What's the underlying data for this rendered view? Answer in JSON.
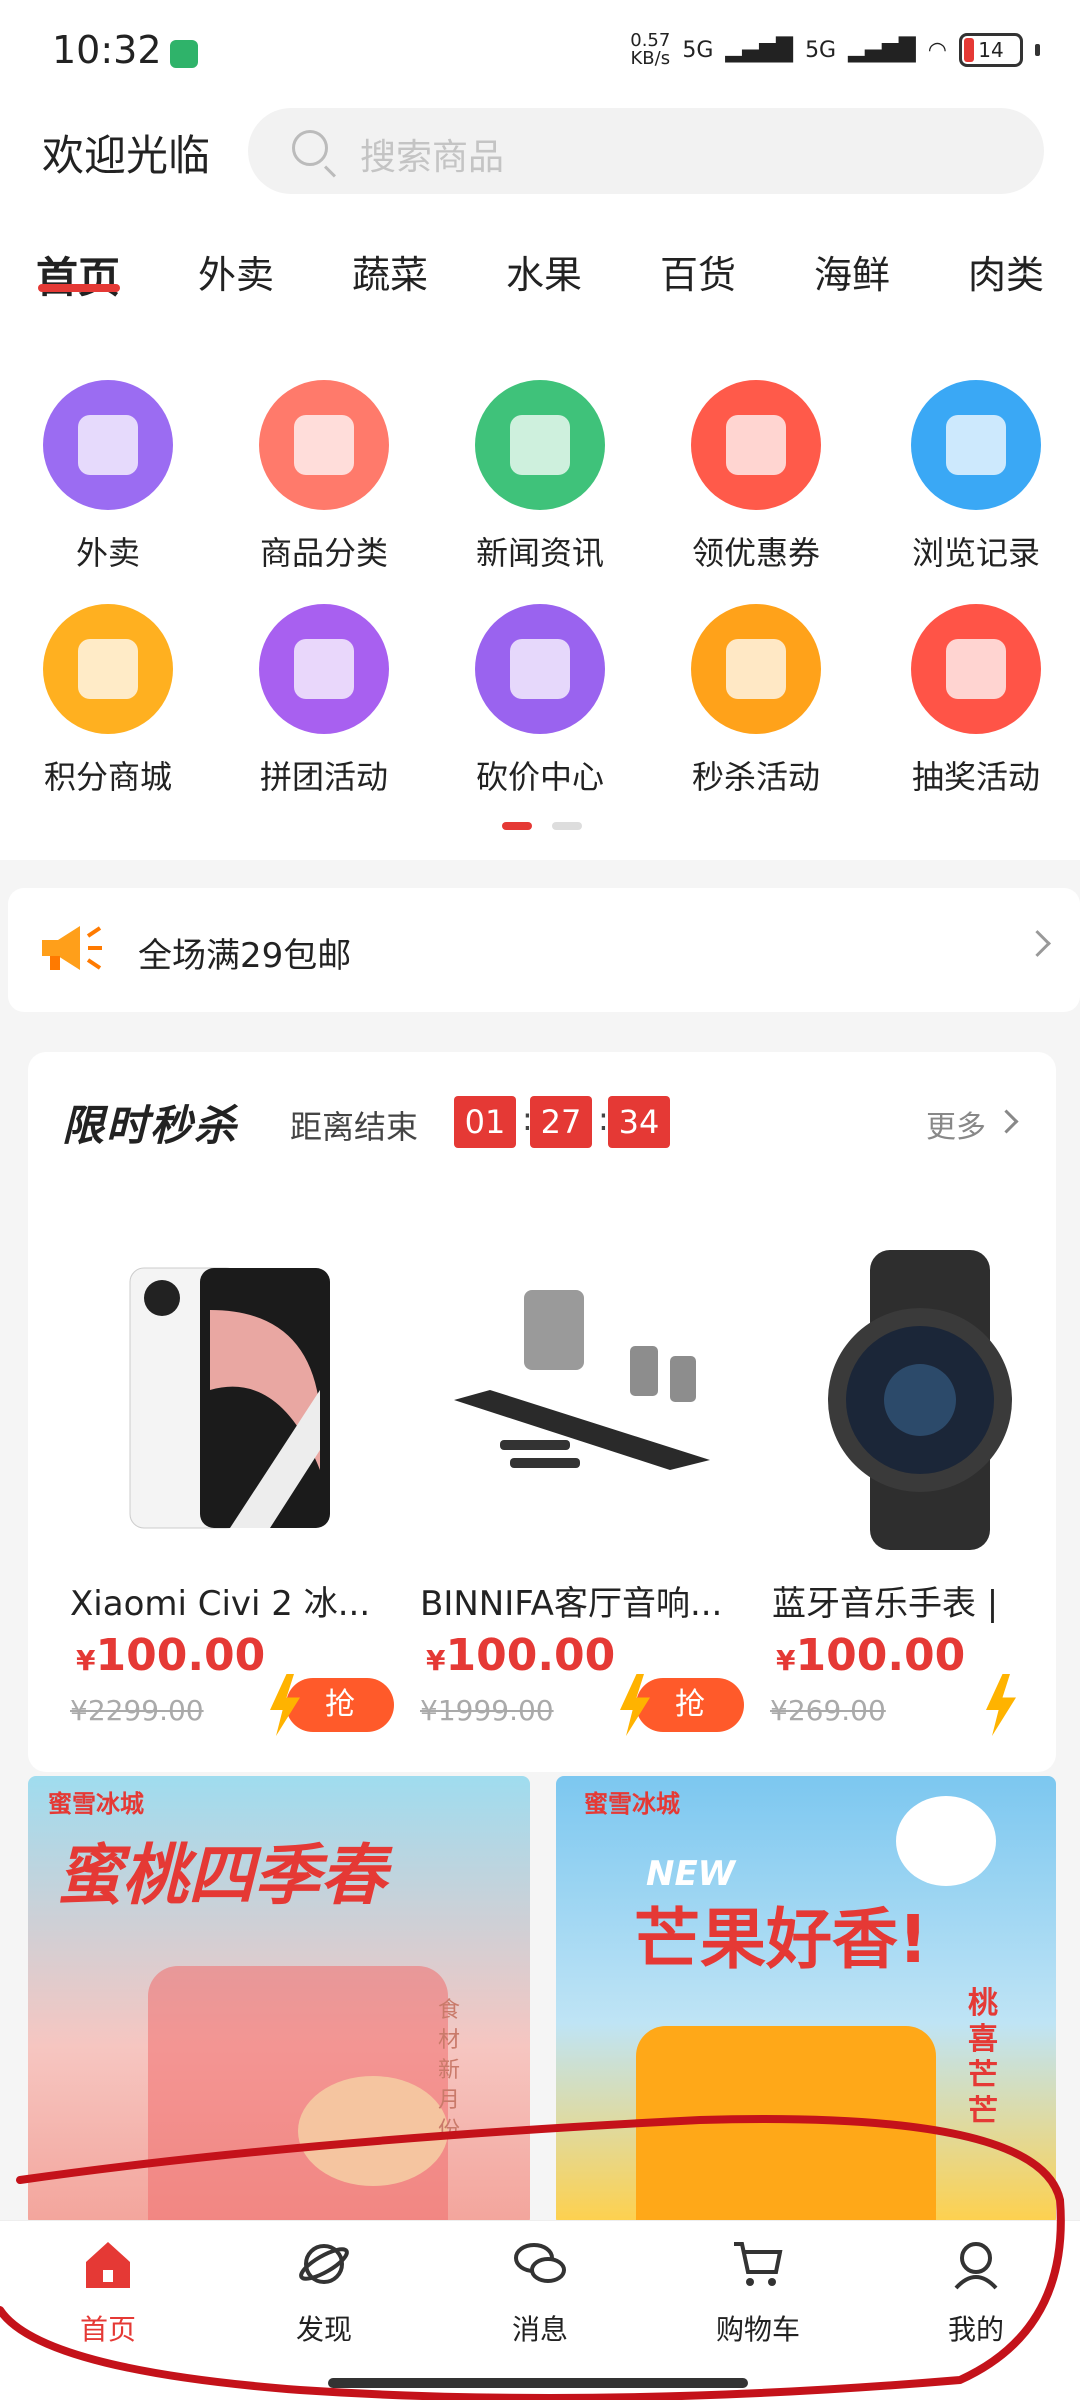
{
  "status_bar": {
    "time": "10:32",
    "net_speed_value": "0.57",
    "net_speed_unit": "KB/s",
    "signal1": "5G",
    "signal2": "5G",
    "battery": "14"
  },
  "header": {
    "welcome": "欢迎光临",
    "search_placeholder": "搜索商品"
  },
  "tabs": [
    "首页",
    "外卖",
    "蔬菜",
    "水果",
    "百货",
    "海鲜",
    "肉类"
  ],
  "grid": [
    {
      "label": "外卖",
      "icon": "map-pin-icon",
      "color": "#9b6cf2"
    },
    {
      "label": "商品分类",
      "icon": "shopping-bag-icon",
      "color": "#ff7a6b"
    },
    {
      "label": "新闻资讯",
      "icon": "folder-icon",
      "color": "#3fc27a"
    },
    {
      "label": "领优惠券",
      "icon": "coupon-icon",
      "color": "#ff5a4a"
    },
    {
      "label": "浏览记录",
      "icon": "notepad-icon",
      "color": "#3aa8f5"
    },
    {
      "label": "积分商城",
      "icon": "wallet-icon",
      "color": "#ffb020"
    },
    {
      "label": "拼团活动",
      "icon": "gift-bag-icon",
      "color": "#a860f0"
    },
    {
      "label": "砍价中心",
      "icon": "box-icon",
      "color": "#9a63ef"
    },
    {
      "label": "秒杀活动",
      "icon": "alarm-clock-icon",
      "color": "#ffa21a"
    },
    {
      "label": "抽奖活动",
      "icon": "lottery-wheel-icon",
      "color": "#ff5447"
    }
  ],
  "notice": {
    "text": "全场满29包邮"
  },
  "flash_sale": {
    "title": "限时秒杀",
    "ends_label": "距离结束",
    "hours": "01",
    "minutes": "27",
    "seconds": "34",
    "more": "更多",
    "products": [
      {
        "name": "Xiaomi Civi 2 冰...",
        "currency": "¥",
        "price": "100.00",
        "orig": "¥2299.00",
        "button": "抢"
      },
      {
        "name": "BINNIFA客厅音响...",
        "currency": "¥",
        "price": "100.00",
        "orig": "¥1999.00",
        "button": "抢"
      },
      {
        "name": "蓝牙音乐手表 |",
        "currency": "¥",
        "price": "100.00",
        "orig": "¥269.00",
        "button": ""
      }
    ]
  },
  "banners": [
    {
      "brand": "蜜雪冰城",
      "title": "蜜桃四季春",
      "tag": "食材新月份"
    },
    {
      "brand": "蜜雪冰城",
      "title": "芒果好香!",
      "badge": "NEW",
      "side": "桃喜芒芒"
    }
  ],
  "bottom_nav": [
    {
      "label": "首页",
      "icon": "home-icon",
      "active": true
    },
    {
      "label": "发现",
      "icon": "planet-icon",
      "active": false
    },
    {
      "label": "消息",
      "icon": "chat-bubbles-icon",
      "active": false
    },
    {
      "label": "购物车",
      "icon": "cart-icon",
      "active": false
    },
    {
      "label": "我的",
      "icon": "user-icon",
      "active": false
    }
  ],
  "colors": {
    "accent": "#e53935",
    "background": "#f5f5f5"
  }
}
